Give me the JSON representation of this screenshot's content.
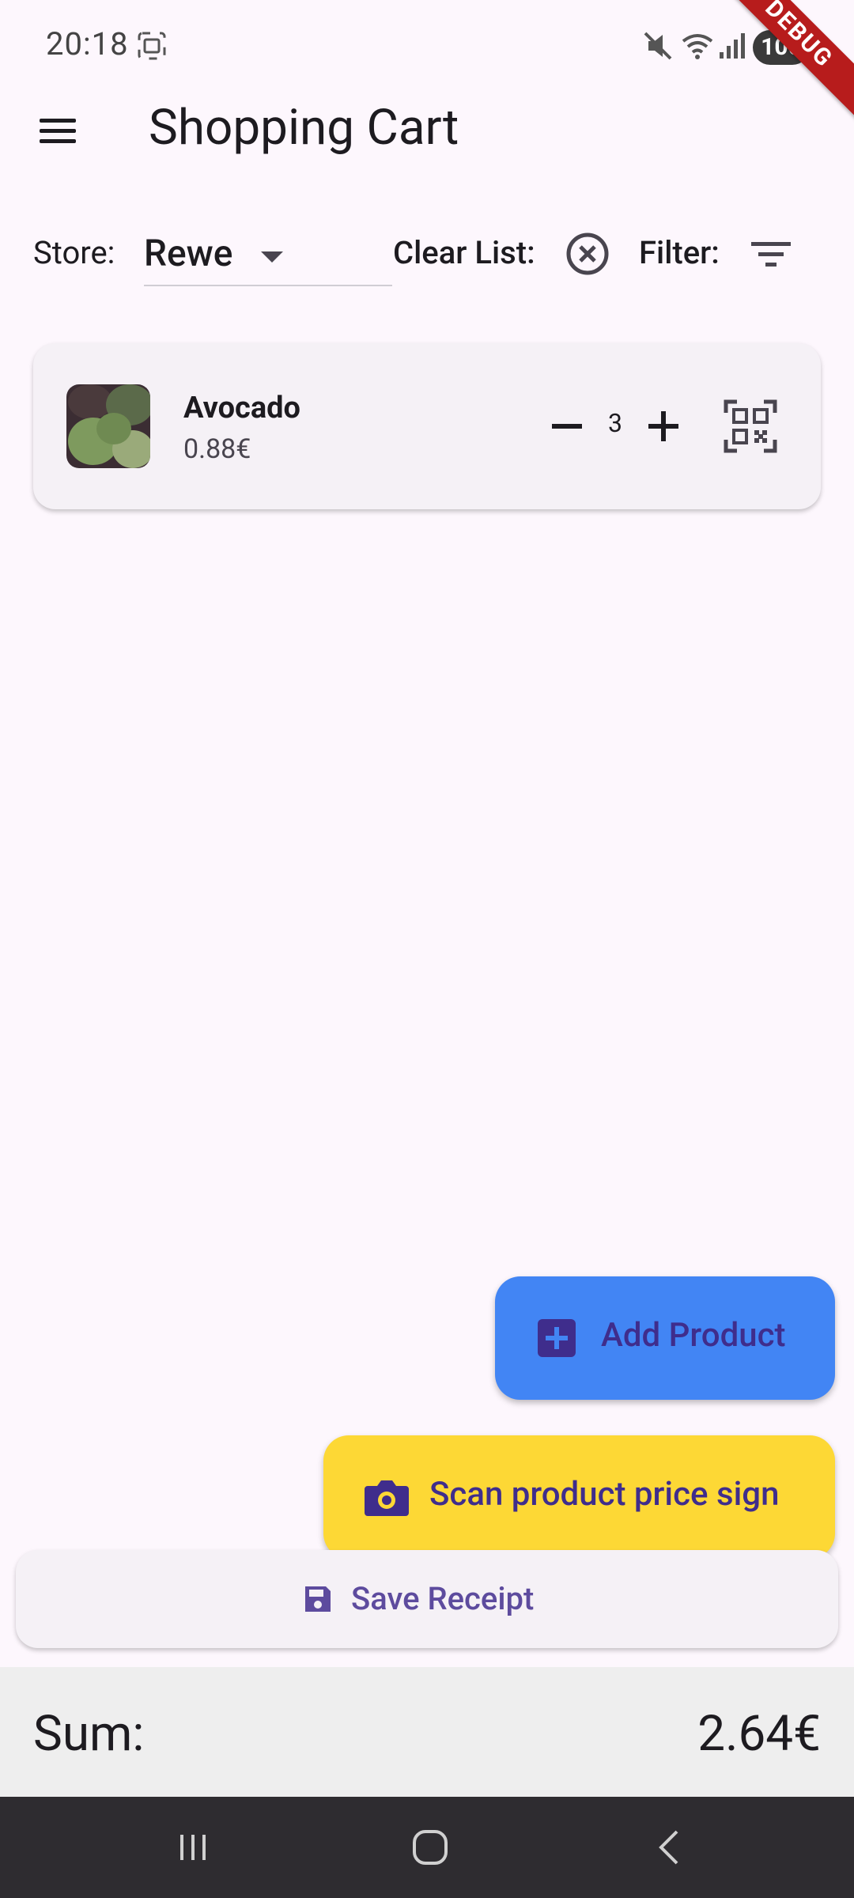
{
  "status_bar": {
    "time": "20:18",
    "battery": "100",
    "debug_label": "DEBUG",
    "icons": [
      "screenshot-icon",
      "mute-icon",
      "wifi-icon",
      "signal-icon",
      "battery-icon"
    ]
  },
  "app_bar": {
    "title": "Shopping Cart",
    "menu_icon": "menu-icon"
  },
  "toolbar": {
    "store_label": "Store:",
    "store_value": "Rewe",
    "clear_label": "Clear List:",
    "filter_label": "Filter:"
  },
  "cart": {
    "items": [
      {
        "name": "Avocado",
        "price": "0.88€",
        "quantity": "3"
      }
    ]
  },
  "actions": {
    "add_product": "Add Product",
    "scan_price_sign": "Scan product price sign",
    "save_receipt": "Save Receipt"
  },
  "summary": {
    "sum_label": "Sum:",
    "sum_value": "2.64€"
  },
  "colors": {
    "background": "#fdf7fd",
    "add_fab": "#4285f4",
    "scan_fab": "#fdd835",
    "accent_text": "#3f2d8c",
    "debug_banner": "#b71c1c"
  }
}
